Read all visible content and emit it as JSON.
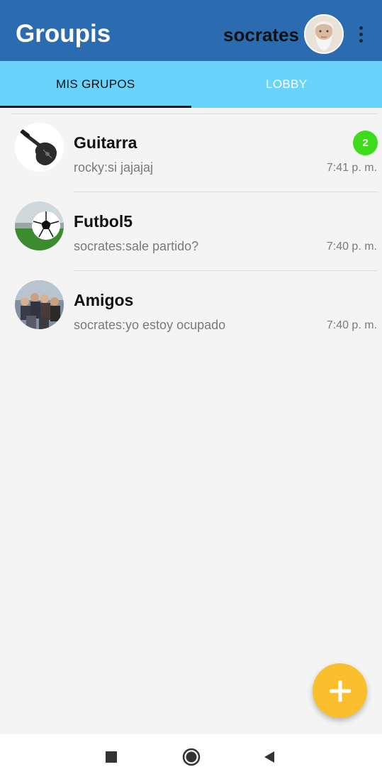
{
  "app": {
    "title": "Groupis",
    "user_name": "socrates"
  },
  "tabs": [
    {
      "label": "MIS GRUPOS",
      "active": true
    },
    {
      "label": "LOBBY",
      "active": false
    }
  ],
  "groups": [
    {
      "name": "Guitarra",
      "last_message": "rocky:si jajajaj",
      "time": "7:41 p. m.",
      "unread": "2"
    },
    {
      "name": "Futbol5",
      "last_message": "socrates:sale partido?",
      "time": "7:40 p. m."
    },
    {
      "name": "Amigos",
      "last_message": "socrates:yo estoy ocupado",
      "time": "7:40 p. m."
    }
  ],
  "colors": {
    "appbar": "#2b6cb0",
    "tabs": "#6ad3fb",
    "badge": "#3ddc1a",
    "fab": "#fbbf2e"
  },
  "icons": {
    "menu": "more-vert-icon",
    "fab": "plus-icon",
    "nav_recent": "square-icon",
    "nav_home": "circle-icon",
    "nav_back": "triangle-back-icon"
  }
}
